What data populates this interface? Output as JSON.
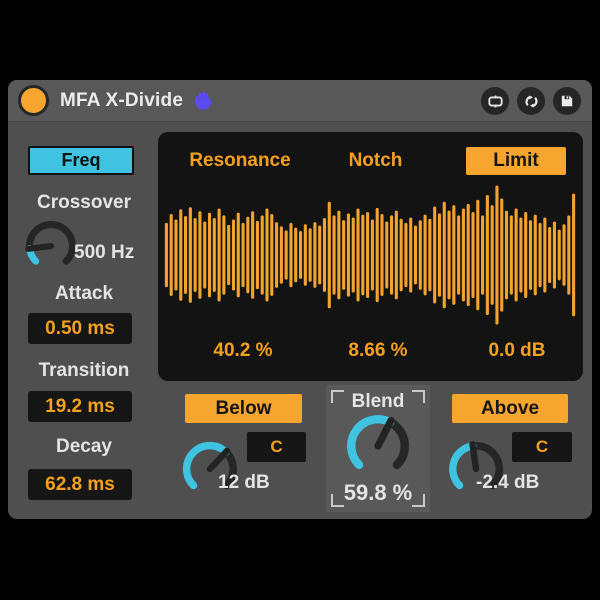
{
  "titlebar": {
    "title": "MFA X-Divide",
    "icons": [
      "hand-icon",
      "frame-icon",
      "sync-icon",
      "save-icon"
    ]
  },
  "left": {
    "freq_button": "Freq",
    "crossover": {
      "label": "Crossover",
      "value": "500 Hz",
      "fraction": 0.14
    },
    "attack": {
      "label": "Attack",
      "value": "0.50 ms"
    },
    "transition": {
      "label": "Transition",
      "value": "19.2 ms"
    },
    "decay": {
      "label": "Decay",
      "value": "62.8 ms"
    }
  },
  "display": {
    "resonance_label": "Resonance",
    "notch_label": "Notch",
    "limit_button": "Limit",
    "resonance_value": "40.2 %",
    "notch_value": "8.66 %",
    "limit_value": "0.0 dB",
    "waveform": [
      0.45,
      0.58,
      0.5,
      0.65,
      0.55,
      0.68,
      0.52,
      0.62,
      0.47,
      0.6,
      0.52,
      0.66,
      0.56,
      0.42,
      0.5,
      0.6,
      0.45,
      0.54,
      0.62,
      0.48,
      0.56,
      0.66,
      0.58,
      0.46,
      0.4,
      0.34,
      0.45,
      0.38,
      0.33,
      0.43,
      0.37,
      0.46,
      0.41,
      0.52,
      0.76,
      0.56,
      0.63,
      0.49,
      0.59,
      0.53,
      0.66,
      0.57,
      0.61,
      0.5,
      0.67,
      0.58,
      0.47,
      0.56,
      0.63,
      0.51,
      0.45,
      0.53,
      0.41,
      0.49,
      0.57,
      0.51,
      0.69,
      0.59,
      0.76,
      0.63,
      0.71,
      0.56,
      0.66,
      0.73,
      0.61,
      0.79,
      0.56,
      0.86,
      0.71,
      1.0,
      0.81,
      0.63,
      0.56,
      0.66,
      0.53,
      0.61,
      0.49,
      0.57,
      0.45,
      0.53,
      0.39,
      0.47,
      0.35,
      0.43,
      0.56,
      0.88
    ]
  },
  "bottom": {
    "below": {
      "button": "Below",
      "c": "C",
      "value": "12 dB",
      "fraction": 0.66
    },
    "blend": {
      "label": "Blend",
      "value": "59.8 %",
      "fraction": 0.6
    },
    "above": {
      "button": "Above",
      "c": "C",
      "value": "-2.4 dB",
      "fraction": 0.47
    }
  },
  "colors": {
    "accent_orange": "#F5A329",
    "accent_cyan": "#40C3E1",
    "panel_black": "#131313",
    "device_gray": "#4f4f4f"
  }
}
